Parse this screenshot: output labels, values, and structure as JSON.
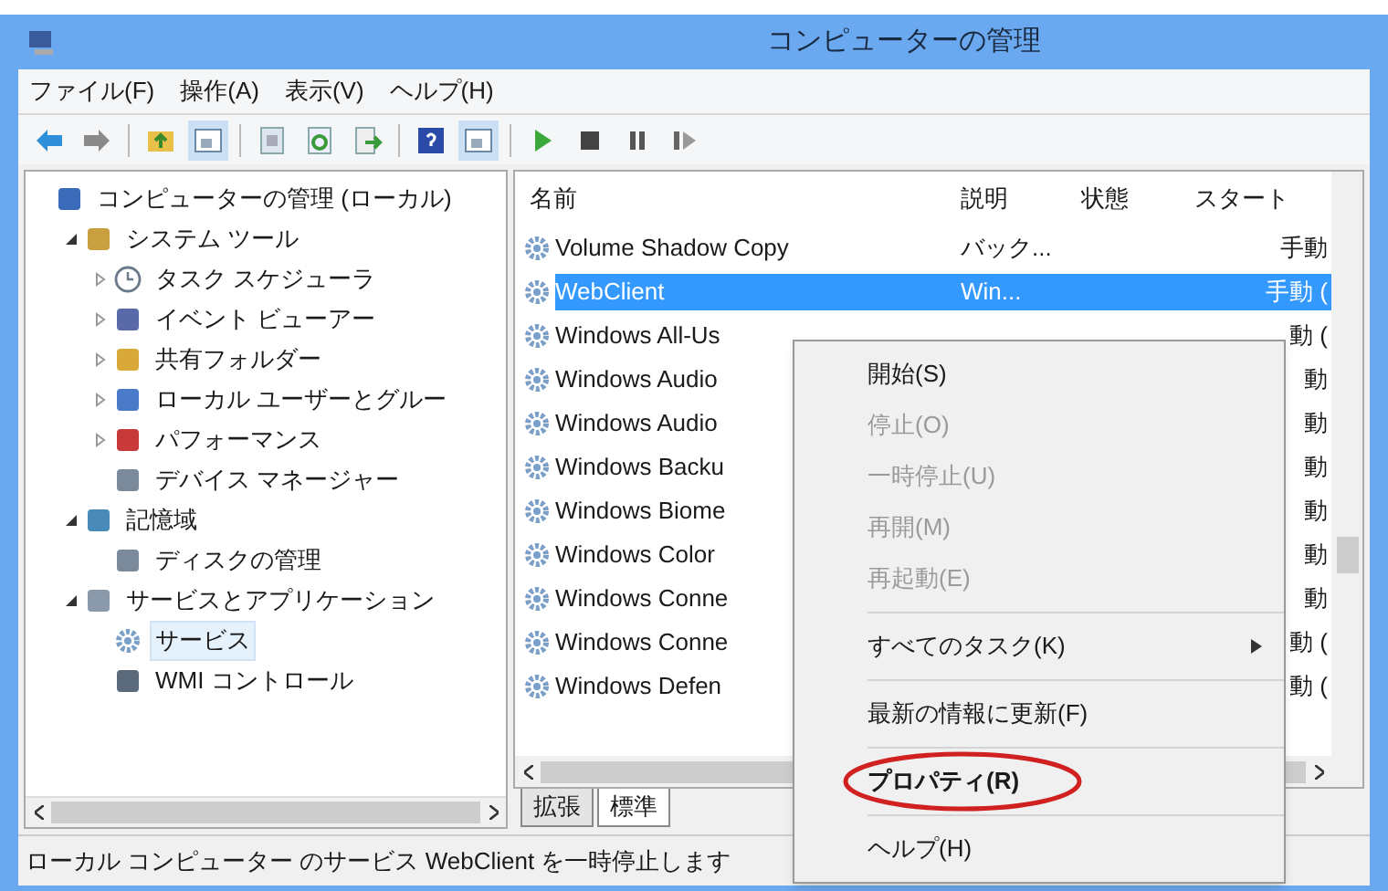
{
  "window": {
    "title": "コンピューターの管理"
  },
  "menu_bar": [
    {
      "label": "ファイル(F)"
    },
    {
      "label": "操作(A)"
    },
    {
      "label": "表示(V)"
    },
    {
      "label": "ヘルプ(H)"
    }
  ],
  "toolbar": [
    {
      "kind": "back"
    },
    {
      "kind": "forward"
    },
    {
      "kind": "sep"
    },
    {
      "kind": "up"
    },
    {
      "kind": "pane",
      "selected": true
    },
    {
      "kind": "sep"
    },
    {
      "kind": "props"
    },
    {
      "kind": "refresh"
    },
    {
      "kind": "export"
    },
    {
      "kind": "sep"
    },
    {
      "kind": "help"
    },
    {
      "kind": "pane",
      "selected": true
    },
    {
      "kind": "sep"
    },
    {
      "kind": "play"
    },
    {
      "kind": "stop"
    },
    {
      "kind": "pause"
    },
    {
      "kind": "resume"
    }
  ],
  "tree": [
    {
      "label": "コンピューターの管理 (ローカル)",
      "selected": false,
      "children": [
        {
          "label": "システム ツール",
          "expanded": true,
          "selected": false,
          "children": [
            {
              "label": "タスク スケジューラ",
              "expanded": false,
              "selected": false
            },
            {
              "label": "イベント ビューアー",
              "expanded": false,
              "selected": false
            },
            {
              "label": "共有フォルダー",
              "expanded": false,
              "selected": false
            },
            {
              "label": "ローカル ユーザーとグルー",
              "expanded": false,
              "selected": false
            },
            {
              "label": "パフォーマンス",
              "expanded": false,
              "selected": false
            },
            {
              "label": "デバイス マネージャー",
              "selected": false
            }
          ]
        },
        {
          "label": "記憶域",
          "expanded": true,
          "selected": false,
          "children": [
            {
              "label": "ディスクの管理",
              "selected": false
            }
          ]
        },
        {
          "label": "サービスとアプリケーション",
          "expanded": true,
          "selected": false,
          "children": [
            {
              "label": "サービス",
              "selected": true
            },
            {
              "label": "WMI コントロール",
              "selected": false
            }
          ]
        }
      ]
    }
  ],
  "table": {
    "columns": [
      "名前",
      "説明",
      "状態",
      "スタート"
    ],
    "rows": [
      {
        "name": "Volume Shadow Copy",
        "description": "バック...",
        "start": "手動",
        "selected": false
      },
      {
        "name": "WebClient",
        "description": "Win...",
        "start": "手動 (",
        "selected": true
      },
      {
        "name": "Windows All-Us",
        "start": "動 (",
        "selected": false
      },
      {
        "name": "Windows Audio",
        "start": "動",
        "selected": false
      },
      {
        "name": "Windows Audio",
        "start": "動",
        "selected": false
      },
      {
        "name": "Windows Backu",
        "start": "動",
        "selected": false
      },
      {
        "name": "Windows Biome",
        "start": "動",
        "selected": false
      },
      {
        "name": "Windows Color",
        "start": "動",
        "selected": false
      },
      {
        "name": "Windows Conne",
        "start": "動",
        "selected": false
      },
      {
        "name": "Windows Conne",
        "start": "動 (",
        "selected": false
      },
      {
        "name": "Windows Defen",
        "start": "動 (",
        "selected": false
      }
    ]
  },
  "view_tabs": [
    {
      "label": "拡張",
      "selected": false
    },
    {
      "label": "標準",
      "selected": true
    }
  ],
  "context_menu": [
    {
      "kind": "item",
      "label": "開始(S)",
      "disabled": false
    },
    {
      "kind": "item",
      "label": "停止(O)",
      "disabled": true
    },
    {
      "kind": "item",
      "label": "一時停止(U)",
      "disabled": true
    },
    {
      "kind": "item",
      "label": "再開(M)",
      "disabled": true
    },
    {
      "kind": "item",
      "label": "再起動(E)",
      "disabled": true
    },
    {
      "kind": "separator"
    },
    {
      "kind": "submenu",
      "label": "すべてのタスク(K)",
      "disabled": false
    },
    {
      "kind": "separator"
    },
    {
      "kind": "item",
      "label": "最新の情報に更新(F)",
      "disabled": false
    },
    {
      "kind": "separator"
    },
    {
      "kind": "highlighted",
      "label": "プロパティ(R)",
      "disabled": false
    },
    {
      "kind": "separator"
    },
    {
      "kind": "item",
      "label": "ヘルプ(H)",
      "disabled": false
    }
  ],
  "status_bar": "ローカル コンピューター のサービス WebClient を一時停止します"
}
